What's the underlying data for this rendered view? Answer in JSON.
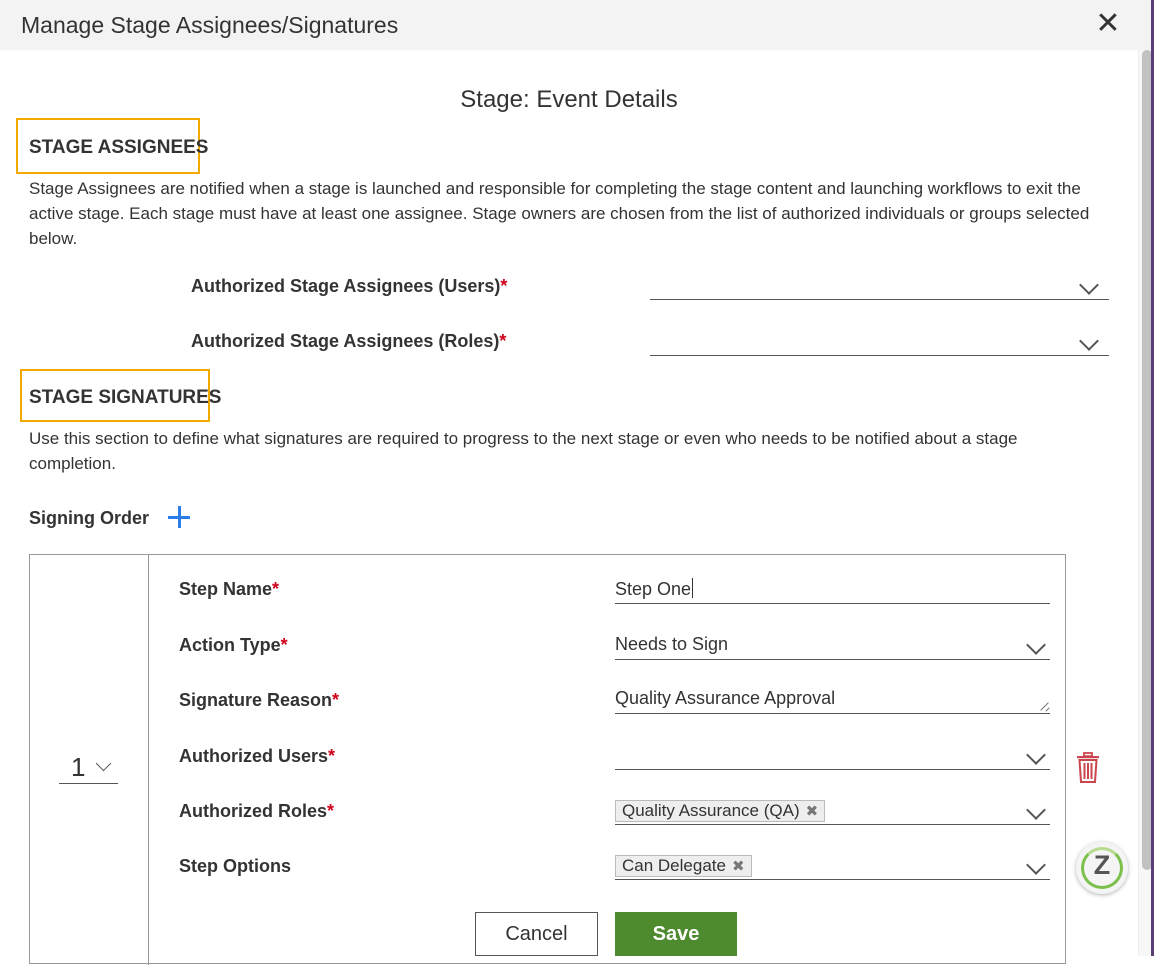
{
  "dialog": {
    "title": "Manage Stage Assignees/Signatures",
    "close_label": "✕"
  },
  "stage_heading": "Stage: Event Details",
  "assignees": {
    "title": "STAGE ASSIGNEES",
    "description_lines": [
      "Stage Assignees are notified when a stage is launched and responsible for completing the stage content and launching workflows to exit the",
      "active stage. Each stage must have at least one assignee. Stage owners are chosen from the list of authorized individuals or groups selected",
      "below."
    ],
    "users_label": "Authorized Stage Assignees (Users)",
    "roles_label": "Authorized Stage Assignees (Roles)",
    "users_value": "",
    "roles_value": ""
  },
  "signatures": {
    "title": "STAGE SIGNATURES",
    "description_lines": [
      "Use this section to define what signatures are required to progress to the next stage or even who needs to be notified about a stage",
      "completion."
    ],
    "signing_order_label": "Signing Order"
  },
  "step": {
    "order": "1",
    "step_name_label": "Step Name",
    "step_name_value": "Step One",
    "action_type_label": "Action Type",
    "action_type_value": "Needs to Sign",
    "signature_reason_label": "Signature Reason",
    "signature_reason_value": "Quality Assurance Approval",
    "authorized_users_label": "Authorized Users",
    "authorized_users_value": "",
    "authorized_roles_label": "Authorized Roles",
    "authorized_roles_tags": [
      "Quality Assurance (QA)"
    ],
    "step_options_label": "Step Options",
    "step_options_tags": [
      "Can Delegate"
    ],
    "required_marker": "*"
  },
  "buttons": {
    "cancel": "Cancel",
    "save": "Save"
  },
  "badge": {
    "letter": "Z"
  },
  "colors": {
    "highlight_box": "#f2a900",
    "save_button": "#4e8a2e",
    "add_icon": "#2b7de9",
    "delete_icon": "#c9464f",
    "required": "#d0021b"
  }
}
